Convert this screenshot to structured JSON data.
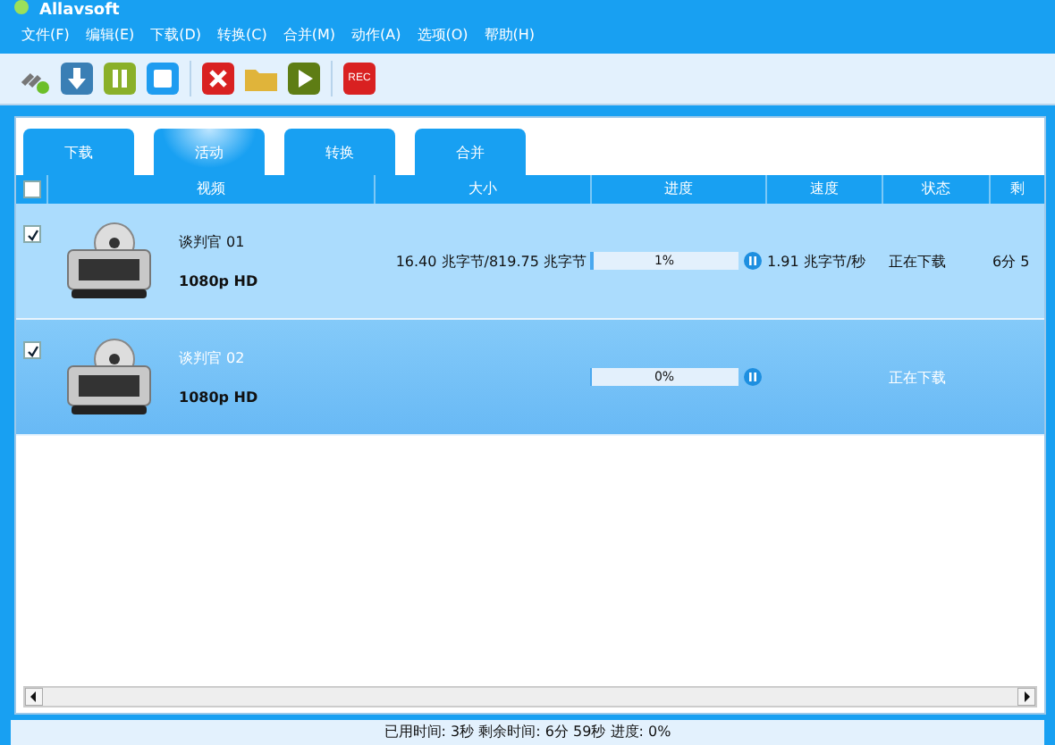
{
  "window": {
    "title": "Allavsoft"
  },
  "menu": [
    "文件(F)",
    "编辑(E)",
    "下载(D)",
    "转换(C)",
    "合并(M)",
    "动作(A)",
    "选项(O)",
    "帮助(H)"
  ],
  "toolbar": [
    {
      "kind": "link"
    },
    {
      "kind": "download"
    },
    {
      "kind": "pause"
    },
    {
      "kind": "stop"
    },
    {
      "kind": "delete"
    },
    {
      "kind": "folder"
    },
    {
      "kind": "play"
    },
    {
      "kind": "rec",
      "label": "REC"
    }
  ],
  "tabs": [
    {
      "label": "下载",
      "selected": false
    },
    {
      "label": "活动",
      "selected": true
    },
    {
      "label": "转换",
      "selected": false
    },
    {
      "label": "合并",
      "selected": false
    }
  ],
  "table": {
    "all_checked": false,
    "columns": [
      "视频",
      "大小",
      "进度",
      "速度",
      "状态",
      "剩"
    ],
    "rows": [
      {
        "checked": true,
        "selected": false,
        "title": "谈判官",
        "number": "01",
        "quality": "1080p HD",
        "size": "16.40 兆字节/819.75 兆字节",
        "level": 0.01,
        "progress": "1%",
        "speed": "1.91 兆字节/秒",
        "status": "正在下载",
        "remaining": "6分 5"
      },
      {
        "checked": true,
        "selected": true,
        "title": "谈判官",
        "number": "02",
        "quality": "1080p HD",
        "size": "",
        "level": 0,
        "progress": "0%",
        "speed": "",
        "status": "正在下载",
        "remaining": ""
      }
    ]
  },
  "status_bar": "已用时间: 3秒 剩余时间: 6分 59秒 进度: 0%"
}
